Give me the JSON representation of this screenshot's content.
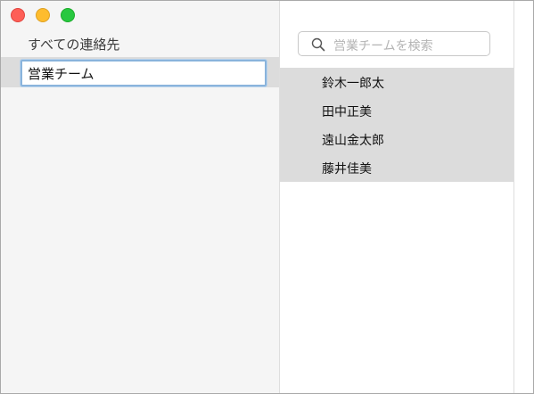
{
  "window": {
    "controls": [
      "close",
      "minimize",
      "maximize"
    ]
  },
  "sidebar": {
    "all_contacts_label": "すべての連絡先",
    "editing_group_value": "営業チーム"
  },
  "contact_list": {
    "search_placeholder": "営業チームを検索",
    "contacts": [
      "鈴木一郎太",
      "田中正美",
      "遠山金太郎",
      "藤井佳美"
    ]
  }
}
